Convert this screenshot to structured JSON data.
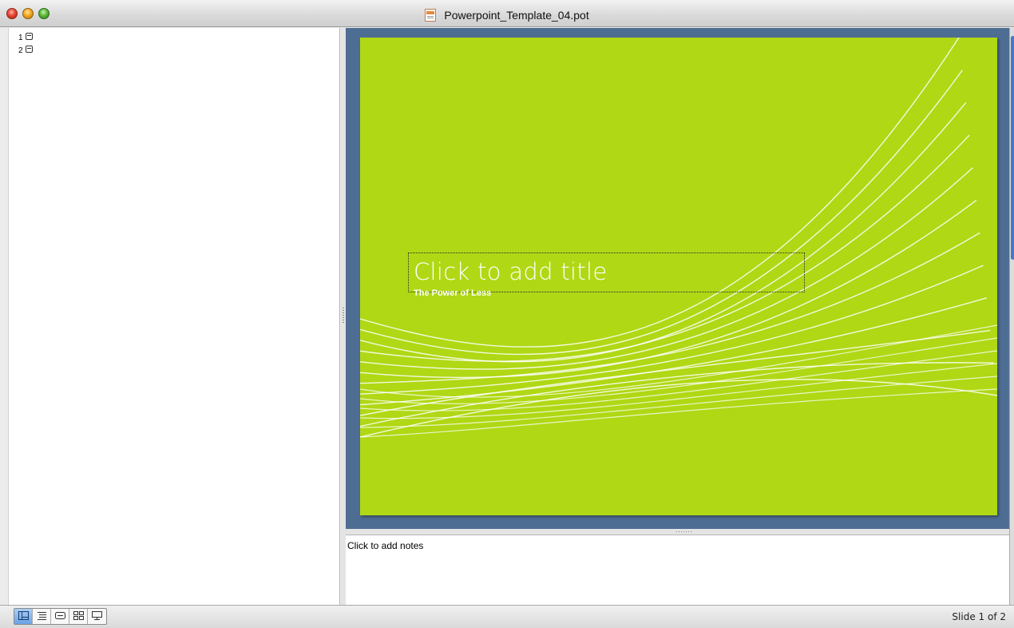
{
  "window": {
    "title": "Powerpoint_Template_04.pot"
  },
  "outline": {
    "slides": [
      {
        "number": "1"
      },
      {
        "number": "2"
      }
    ]
  },
  "slide": {
    "title_placeholder": "Click to add title",
    "subtitle": "The Power of Less",
    "background_color": "#b0d815",
    "pane_color": "#4e6d93"
  },
  "notes": {
    "placeholder": "Click to add notes"
  },
  "view_buttons": [
    {
      "name": "normal-view",
      "icon": "normal-view-icon",
      "active": true
    },
    {
      "name": "outline-view",
      "icon": "outline-view-icon",
      "active": false
    },
    {
      "name": "slide-view",
      "icon": "slide-view-icon",
      "active": false
    },
    {
      "name": "slide-sorter-view",
      "icon": "slide-sorter-icon",
      "active": false
    },
    {
      "name": "slide-show",
      "icon": "slide-show-icon",
      "active": false
    }
  ],
  "status": {
    "slide_indicator": "Slide 1 of 2"
  }
}
